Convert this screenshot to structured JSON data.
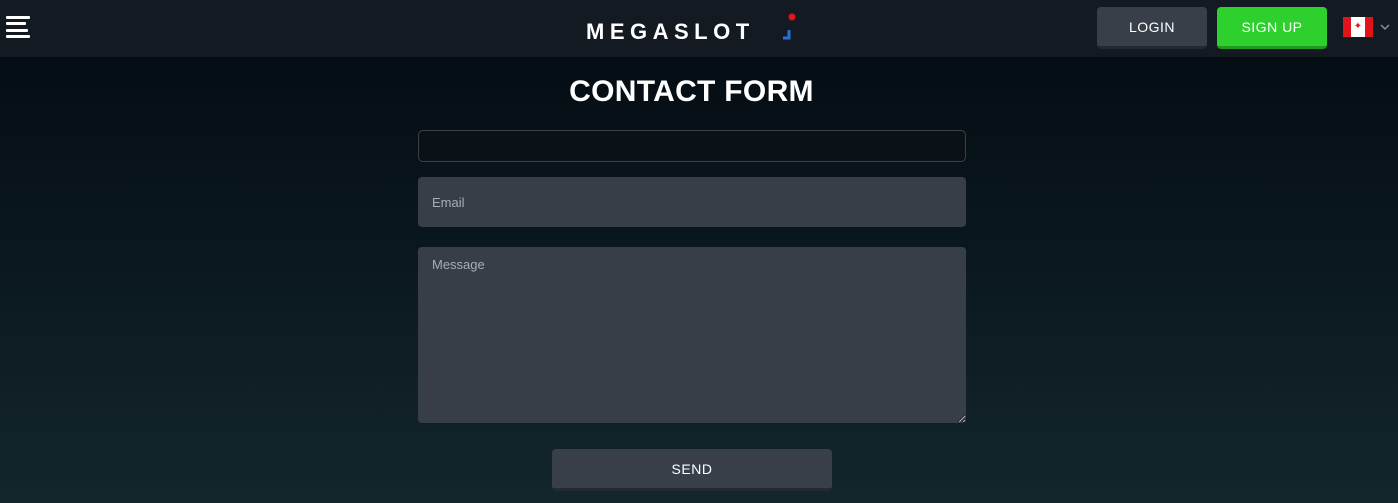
{
  "header": {
    "menu_icon": "hamburger-menu-icon",
    "logo_text": "MEGASLOT",
    "login_label": "LOGIN",
    "signup_label": "SIGN UP",
    "language_flag": "canada-flag-icon",
    "language_chevron": "chevron-down-icon"
  },
  "contact_form": {
    "title": "CONTACT FORM",
    "name_field": {
      "value": "",
      "placeholder": ""
    },
    "email_field": {
      "value": "",
      "placeholder": "Email"
    },
    "message_field": {
      "value": "",
      "placeholder": "Message"
    },
    "send_label": "SEND"
  },
  "colors": {
    "header_bg": "#141a21",
    "login_bg": "#383f49",
    "signup_bg": "#2ed02e",
    "field_bg": "#383e47",
    "logo_accent_blue": "#2c6fd6",
    "logo_accent_red": "#e1141c"
  }
}
